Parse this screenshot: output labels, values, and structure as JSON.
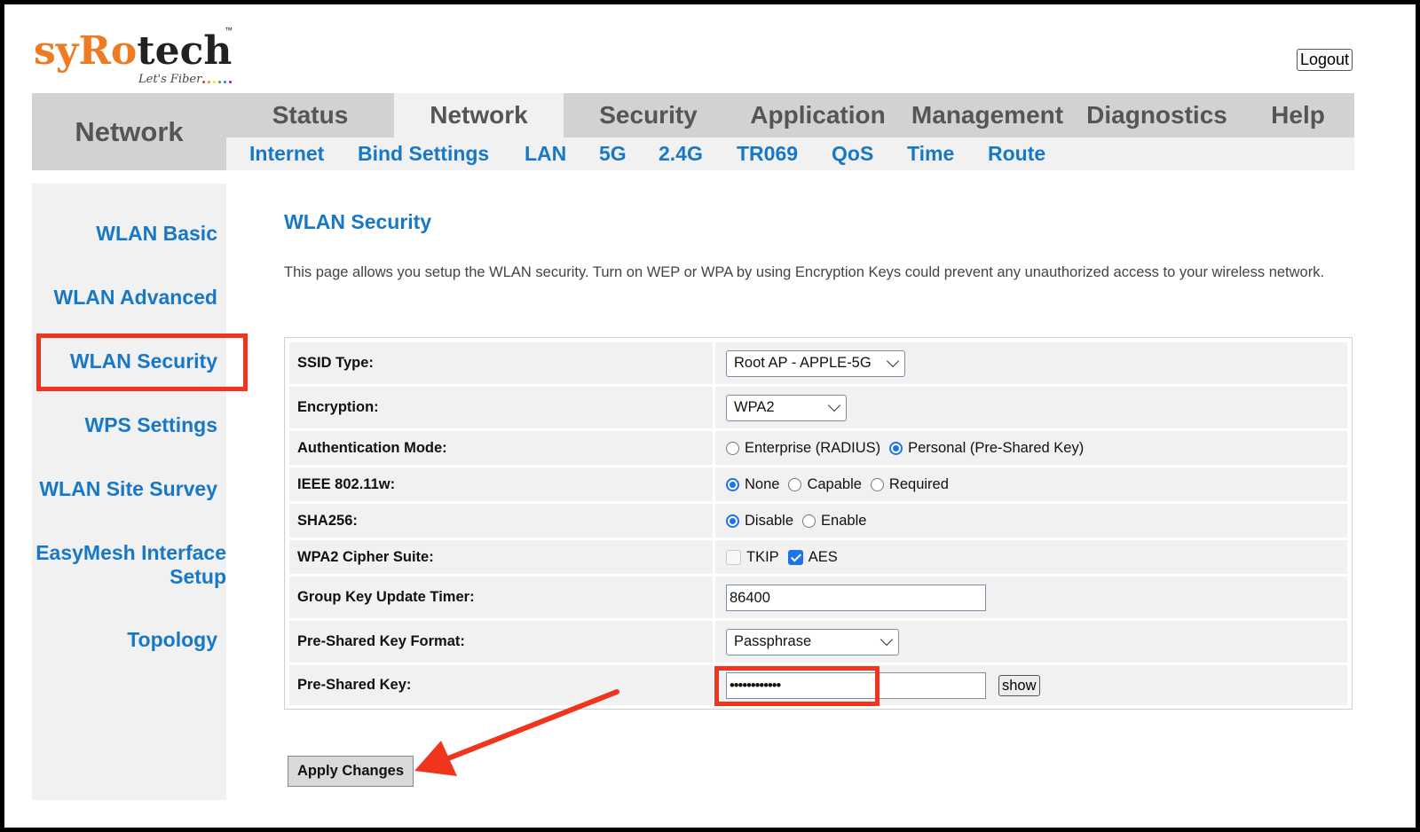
{
  "logo": {
    "text_part1": "sy",
    "text_part2": "R",
    "text_part3": "o",
    "text_part4": "tech",
    "trademark": "™",
    "tagline": "Let's Fiber",
    "dot_colors": [
      "#e53935",
      "#fb8c00",
      "#fdd835",
      "#43a047",
      "#1e88e5",
      "#8e24aa"
    ]
  },
  "header": {
    "logout_label": "Logout"
  },
  "nav": {
    "section_title": "Network",
    "main_tabs": [
      "Status",
      "Network",
      "Security",
      "Application",
      "Management",
      "Diagnostics",
      "Help"
    ],
    "active_main_tab": "Network",
    "sub_tabs": [
      "Internet",
      "Bind Settings",
      "LAN",
      "5G",
      "2.4G",
      "TR069",
      "QoS",
      "Time",
      "Route"
    ]
  },
  "sidebar": {
    "items": [
      "WLAN Basic",
      "WLAN Advanced",
      "WLAN Security",
      "WPS Settings",
      "WLAN Site Survey",
      "EasyMesh Interface Setup",
      "Topology"
    ],
    "highlighted": "WLAN Security"
  },
  "page": {
    "title": "WLAN Security",
    "description": "This page allows you setup the WLAN security. Turn on WEP or WPA by using Encryption Keys could prevent any unauthorized access to your wireless network."
  },
  "form": {
    "ssid_type": {
      "label": "SSID Type:",
      "value": "Root AP - APPLE-5G"
    },
    "encryption": {
      "label": "Encryption:",
      "value": "WPA2"
    },
    "auth_mode": {
      "label": "Authentication Mode:",
      "options": [
        "Enterprise (RADIUS)",
        "Personal (Pre-Shared Key)"
      ],
      "selected": "Personal (Pre-Shared Key)"
    },
    "ieee_80211w": {
      "label": "IEEE 802.11w:",
      "options": [
        "None",
        "Capable",
        "Required"
      ],
      "selected": "None"
    },
    "sha256": {
      "label": "SHA256:",
      "options": [
        "Disable",
        "Enable"
      ],
      "selected": "Disable"
    },
    "cipher_suite": {
      "label": "WPA2 Cipher Suite:",
      "options": [
        "TKIP",
        "AES"
      ],
      "checked": [
        "AES"
      ]
    },
    "group_key_timer": {
      "label": "Group Key Update Timer:",
      "value": "86400"
    },
    "psk_format": {
      "label": "Pre-Shared Key Format:",
      "value": "Passphrase"
    },
    "psk": {
      "label": "Pre-Shared Key:",
      "value": "••••••••••••",
      "show_label": "show"
    }
  },
  "actions": {
    "apply_label": "Apply Changes"
  },
  "annotation_color": "#f0351f"
}
